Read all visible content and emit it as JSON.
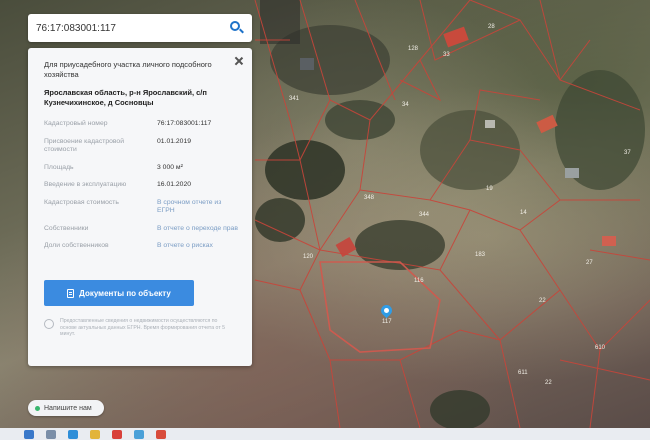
{
  "search": {
    "value": "76:17:083001:117"
  },
  "card": {
    "purpose": "Для приусадебного участка личного подсобного хозяйства",
    "address": "Ярославская область, р-н Ярославский, с/п Кузнечихинское, д Сосновцы",
    "rows": [
      {
        "label": "Кадастровый номер",
        "value": "76:17:083001:117",
        "link": false
      },
      {
        "label": "Присвоение кадастровой стоимости",
        "value": "01.01.2019",
        "link": false
      },
      {
        "label": "Площадь",
        "value": "3 000 м²",
        "link": false
      },
      {
        "label": "Введение в эксплуатацию",
        "value": "16.01.2020",
        "link": false
      },
      {
        "label": "Кадастровая стоимость",
        "value": "В срочном отчете из ЕГРН",
        "link": true
      },
      {
        "label": "Собственники",
        "value": "В отчете о переходе прав",
        "link": true
      },
      {
        "label": "Доли собственников",
        "value": "В отчете о рисках",
        "link": true
      }
    ],
    "docs_button": "Документы по объекту",
    "disclaimer": "Предоставленные сведения о недвижимости осуществляются по основе актуальных данных ЕГРН. Время формирования отчета от 5 минут."
  },
  "chat": {
    "label": "Напишите нам"
  },
  "map": {
    "pin_label": "117",
    "parcel_labels": [
      "341",
      "348",
      "344",
      "120",
      "116",
      "183",
      "22",
      "27",
      "22",
      "610",
      "611",
      "128",
      "14",
      "28",
      "19",
      "33",
      "34",
      "37"
    ]
  },
  "colors": {
    "accent": "#3b8be0",
    "boundary": "#c8453a",
    "link": "#7a9cc4"
  },
  "icons": [
    "search-icon",
    "close-icon",
    "document-icon",
    "info-icon",
    "chat-dot-icon",
    "location-pin-icon"
  ]
}
